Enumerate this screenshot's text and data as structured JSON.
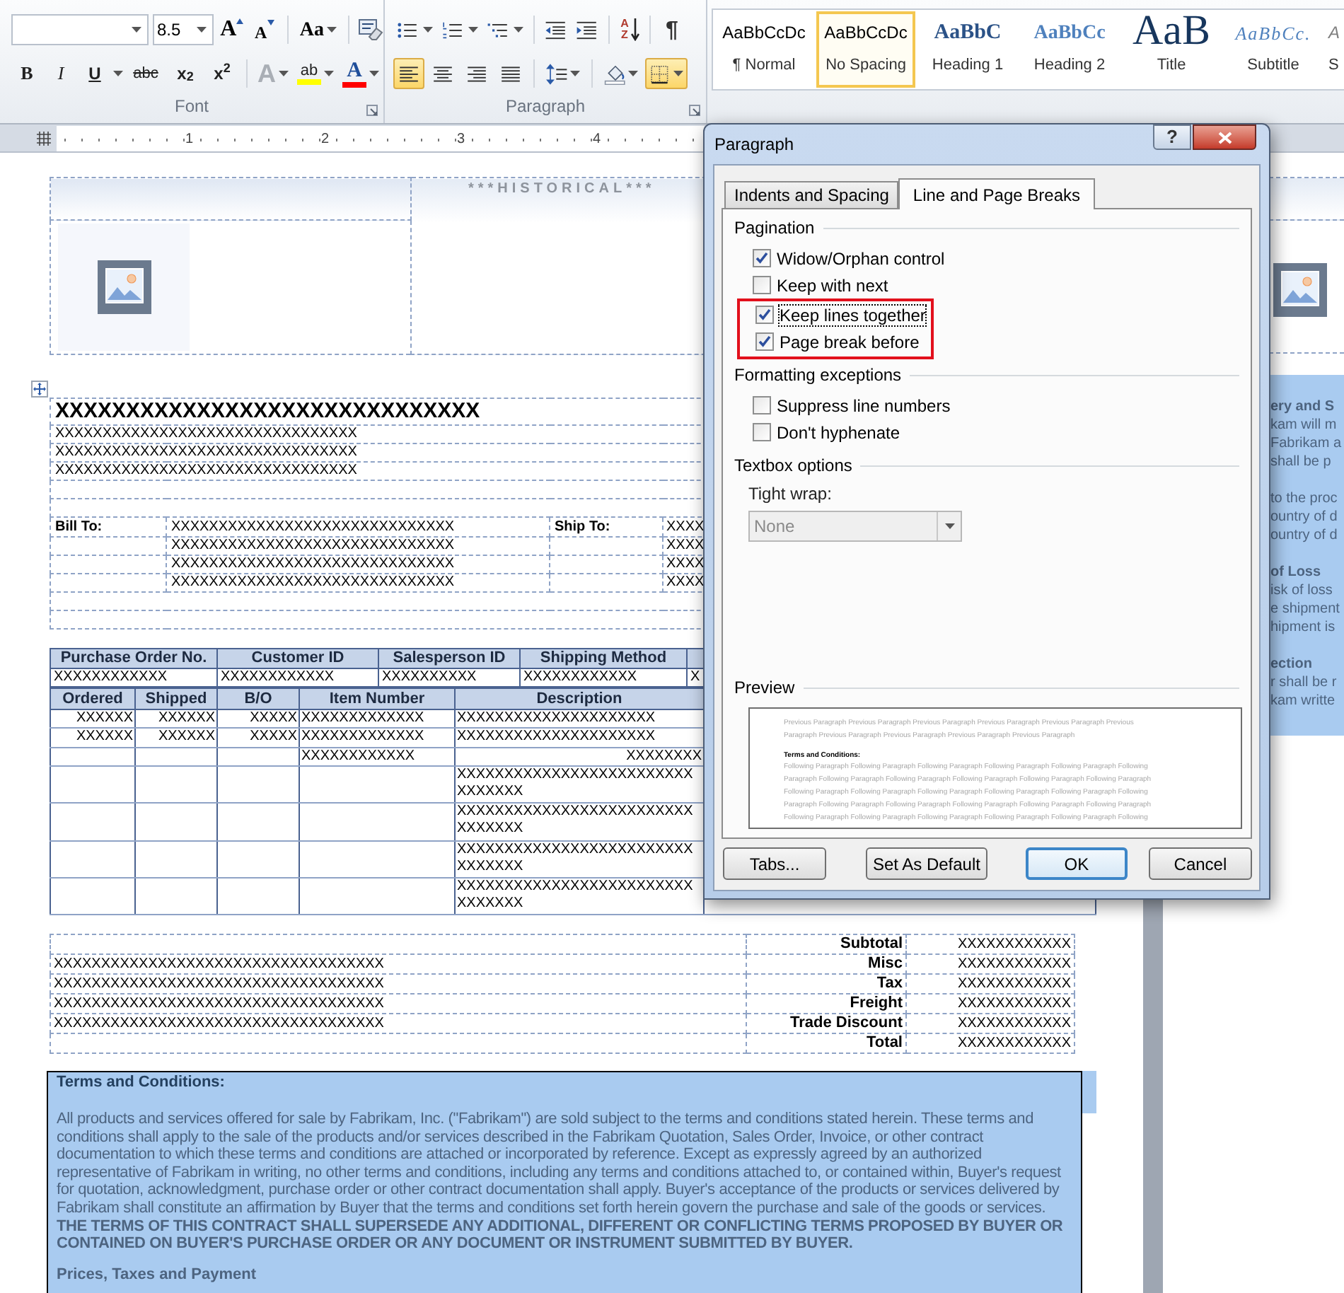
{
  "ribbon": {
    "font_group": {
      "label": "Font",
      "font_size": "8.5",
      "size_buttons": [
        {
          "kind": "grow",
          "label": "A"
        },
        {
          "kind": "shrink",
          "label": "A"
        }
      ],
      "case_button": {
        "label": "Aa"
      },
      "format_buttons": [
        {
          "kind": "bold",
          "label": "B"
        },
        {
          "kind": "italic",
          "label": "I"
        },
        {
          "kind": "underline",
          "label": "U"
        },
        {
          "kind": "strike",
          "label": "abc"
        },
        {
          "kind": "subscript",
          "label": "x$_{2}$"
        },
        {
          "kind": "superscript",
          "label": "x$^{2}$"
        }
      ],
      "color_buttons": [
        {
          "kind": "effects",
          "label": "A",
          "disabled": true
        },
        {
          "kind": "highlight",
          "label": "ab",
          "disabled": false,
          "color": "#ffff00"
        },
        {
          "kind": "font_color",
          "label": "A",
          "disabled": false,
          "color": "#ff0000"
        }
      ]
    },
    "paragraph_group": {
      "label": "Paragraph",
      "top_buttons": [
        {
          "kind": "bullets"
        },
        {
          "kind": "numbering"
        },
        {
          "kind": "multilevel"
        },
        {
          "kind": "decrease_indent"
        },
        {
          "kind": "increase_indent"
        },
        {
          "kind": "sort",
          "label": "AZ"
        },
        {
          "kind": "pilcrow",
          "label": "¶"
        }
      ],
      "bottom_buttons": [
        {
          "kind": "align_left",
          "selected": true
        },
        {
          "kind": "align_center",
          "selected": false
        },
        {
          "kind": "align_right",
          "selected": false
        },
        {
          "kind": "justify",
          "selected": false
        },
        {
          "kind": "line_spacing",
          "selected": false
        },
        {
          "kind": "shading",
          "selected": false
        },
        {
          "kind": "borders",
          "selected": true
        }
      ]
    },
    "styles": [
      {
        "kind": "normal",
        "sample": "AaBbCcDc",
        "label": "¶ Normal",
        "selected": false
      },
      {
        "kind": "normal",
        "sample": "AaBbCcDc",
        "label": "No Spacing",
        "selected": true
      },
      {
        "kind": "heading1",
        "sample": "AaBbC",
        "label": "Heading 1",
        "selected": false
      },
      {
        "kind": "heading2",
        "sample": "AaBbCc",
        "label": "Heading 2",
        "selected": false
      },
      {
        "kind": "title",
        "sample": "AaB",
        "label": "Title",
        "selected": false
      },
      {
        "kind": "subtitle",
        "sample": "AaBbCc.",
        "label": "Subtitle",
        "selected": false
      },
      {
        "kind": "subtle",
        "sample": "A",
        "label": "S",
        "selected": false
      }
    ]
  },
  "ruler": {
    "numbers": [
      "1",
      "2",
      "3",
      "4"
    ]
  },
  "document": {
    "header": {
      "historical": "***HISTORICAL***"
    },
    "company": {
      "name": "XXXXXXXXXXXXXXXXXXXXXXXXXXXXXX",
      "address_lines": [
        "XXXXXXXXXXXXXXXXXXXXXXXXXXXXXXXX",
        "XXXXXXXXXXXXXXXXXXXXXXXXXXXXXXXX",
        "XXXXXXXXXXXXXXXXXXXXXXXXXXXXXXXX"
      ]
    },
    "addresses": {
      "bill_to_label": "Bill To:",
      "bill_to_lines": [
        "XXXXXXXXXXXXXXXXXXXXXXXXXXXXXX",
        "XXXXXXXXXXXXXXXXXXXXXXXXXXXXXX",
        "XXXXXXXXXXXXXXXXXXXXXXXXXXXXXX",
        "XXXXXXXXXXXXXXXXXXXXXXXXXXXXXX"
      ],
      "ship_to_label": "Ship To:",
      "ship_to_lines": [
        "XXXX",
        "XXXX",
        "XXXX",
        "XXXX"
      ]
    },
    "order_table": {
      "columns": [
        "Purchase Order No.",
        "Customer ID",
        "Salesperson ID",
        "Shipping Method"
      ],
      "values": [
        "XXXXXXXXXXXX",
        "XXXXXXXXXXXX",
        "XXXXXXXXXX",
        "XXXXXXXXXXXX",
        "X"
      ]
    },
    "items_table": {
      "columns": [
        "Ordered",
        "Shipped",
        "B/O",
        "Item Number",
        "Description"
      ],
      "rows": [
        [
          "XXXXXX",
          "XXXXXX",
          "XXXXX",
          "XXXXXXXXXXXXX",
          "XXXXXXXXXXXXXXXXXXXXX"
        ],
        [
          "XXXXXX",
          "XXXXXX",
          "XXXXX",
          "XXXXXXXXXXXXX",
          "XXXXXXXXXXXXXXXXXXXXX"
        ],
        [
          "",
          "",
          "",
          "XXXXXXXXXXXX",
          "XXXXXXXX"
        ],
        [
          "",
          "",
          "",
          "",
          "XXXXXXXXXXXXXXXXXXXXXXXXXXXXXXXX"
        ],
        [
          "",
          "",
          "",
          "",
          "XXXXXXXXXXXXXXXXXXXXXXXXXXXXXXXX"
        ],
        [
          "",
          "",
          "",
          "",
          "XXXXXXXXXXXXXXXXXXXXXXXXXXXXXXXX"
        ],
        [
          "",
          "",
          "",
          "",
          "XXXXXXXXXXXXXXXXXXXXXXXXXXXXXXXX"
        ]
      ]
    },
    "totals": [
      {
        "label": "Subtotal",
        "value": "XXXXXXXXXXXX"
      },
      {
        "text": "XXXXXXXXXXXXXXXXXXXXXXXXXXXXXXXXXXX",
        "label": "Misc",
        "value": "XXXXXXXXXXXX"
      },
      {
        "text": "XXXXXXXXXXXXXXXXXXXXXXXXXXXXXXXXXXX",
        "label": "Tax",
        "value": "XXXXXXXXXXXX"
      },
      {
        "text": "XXXXXXXXXXXXXXXXXXXXXXXXXXXXXXXXXXX",
        "label": "Freight",
        "value": "XXXXXXXXXXXX"
      },
      {
        "text": "XXXXXXXXXXXXXXXXXXXXXXXXXXXXXXXXXXX",
        "label": "Trade Discount",
        "value": "XXXXXXXXXXXX"
      },
      {
        "label": "Total",
        "value": "XXXXXXXXXXXX"
      }
    ],
    "terms": {
      "heading": "Terms and Conditions:",
      "paragraph": "All products and services offered for sale by Fabrikam, Inc. (\"Fabrikam\") are sold subject to the terms and conditions stated herein. These terms and conditions shall apply to the sale of the products and/or services described in the Fabrikam Quotation, Sales Order, Invoice, or other contract documentation to which these terms and conditions are attached or incorporated by reference. Except as expressly agreed by an authorized representative of Fabrikam in writing, no other terms and conditions, including any terms and conditions attached to, or contained within, Buyer's request for quotation, acknowledgment, purchase order or other contract documentation shall apply. Buyer's acceptance of the products or services delivered by Fabrikam shall constitute an affirmation by Buyer that the terms and conditions set forth herein govern the purchase and sale of the goods or services. **THE TERMS OF THIS CONTRACT SHALL SUPERSEDE ANY ADDITIONAL, DIFFERENT OR CONFLICTING TERMS PROPOSED BY BUYER OR CONTAINED ON BUYER'S PURCHASE ORDER OR ANY DOCUMENT OR INSTRUMENT SUBMITTED BY BUYER.**",
      "next_heading": "Prices, Taxes and Payment"
    },
    "next_page": {
      "groups": [
        {
          "heading": "ery and S",
          "lines": [
            "kam will m",
            "Fabrikam a",
            "shall be p"
          ]
        },
        {
          "lines": [
            "to the proc",
            "ountry of d",
            "ountry of d"
          ]
        },
        {
          "heading": "of Loss",
          "lines": [
            "isk of loss",
            "e shipment",
            "hipment is"
          ]
        },
        {
          "heading": "ection",
          "lines": [
            "r shall be r",
            "kam writte"
          ]
        }
      ]
    }
  },
  "dialog": {
    "title": "Paragraph",
    "help": "?",
    "tabs": [
      {
        "label": "Indents and Spacing",
        "selected": false
      },
      {
        "label": "Line and Page Breaks",
        "selected": true
      }
    ],
    "pagination": {
      "label": "Pagination",
      "options": [
        {
          "label": "Widow/Orphan control",
          "checked": true,
          "focused": false,
          "highlighted": false
        },
        {
          "label": "Keep with next",
          "checked": false,
          "focused": false,
          "highlighted": false
        },
        {
          "label": "Keep lines together",
          "checked": true,
          "focused": true,
          "highlighted": true
        },
        {
          "label": "Page break before",
          "checked": true,
          "focused": false,
          "highlighted": true
        }
      ]
    },
    "formatting_exceptions": {
      "label": "Formatting exceptions",
      "options": [
        {
          "label": "Suppress line numbers",
          "checked": false,
          "focused": false,
          "highlighted": false
        },
        {
          "label": "Don't hyphenate",
          "checked": false,
          "focused": false,
          "highlighted": false
        }
      ]
    },
    "textbox_options": {
      "label": "Textbox options",
      "tight_wrap_label": "Tight wrap:",
      "tight_wrap_value": "None",
      "disabled": true
    },
    "preview": {
      "label": "Preview",
      "previous_lines": [
        "Previous Paragraph Previous Paragraph Previous Paragraph Previous Paragraph Previous Paragraph Previous",
        "Paragraph Previous Paragraph Previous Paragraph Previous Paragraph Previous Paragraph"
      ],
      "heading": "Terms and Conditions:",
      "following_lines": [
        "Following Paragraph Following Paragraph Following Paragraph Following Paragraph Following Paragraph Following",
        "Paragraph Following Paragraph Following Paragraph Following Paragraph Following Paragraph Following Paragraph",
        "Following Paragraph Following Paragraph Following Paragraph Following Paragraph Following Paragraph Following",
        "Paragraph Following Paragraph Following Paragraph Following Paragraph Following Paragraph Following Paragraph",
        "Following Paragraph Following Paragraph Following Paragraph Following Paragraph Following Paragraph Following"
      ]
    },
    "buttons": [
      {
        "label": "Tabs...",
        "default": false
      },
      {
        "label": "Set As Default",
        "default": false
      },
      {
        "label": "OK",
        "default": true
      },
      {
        "label": "Cancel",
        "default": false
      }
    ]
  }
}
